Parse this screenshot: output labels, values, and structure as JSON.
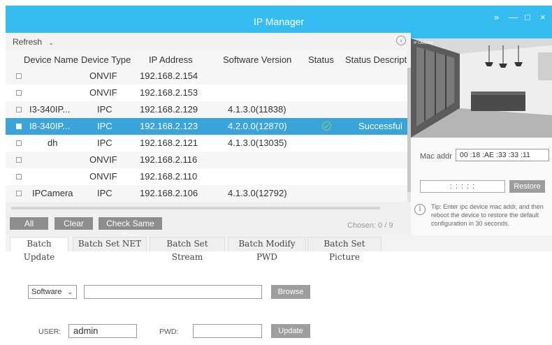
{
  "window": {
    "title": "IP Manager",
    "controls": [
      "»",
      "—",
      "□",
      "×"
    ],
    "accent_color": "#35bdf1",
    "selected_row_color": "#3aa3d9"
  },
  "toolbar": {
    "refresh_label": "Refresh",
    "refresh_icon": "chevron-down-icon",
    "next_icon": "circle-arrow-right-icon"
  },
  "table": {
    "columns": [
      "Device Name",
      "Device Type",
      "IP Address",
      "Software Version",
      "Status",
      "Status Description"
    ],
    "rows": [
      {
        "name": "",
        "type": "ONVIF",
        "ip": "192.168.2.154",
        "version": "",
        "status": "",
        "description": ""
      },
      {
        "name": "",
        "type": "ONVIF",
        "ip": "192.168.2.153",
        "version": "",
        "status": "",
        "description": ""
      },
      {
        "name": "I3-340IP...",
        "type": "IPC",
        "ip": "192.168.2.129",
        "version": "4.1.3.0(11838)",
        "status": "",
        "description": ""
      },
      {
        "name": "I8-340IP...",
        "type": "IPC",
        "ip": "192.168.2.123",
        "version": "4.2.0.0(12870)",
        "status": "ok",
        "description": "Successful"
      },
      {
        "name": "dh",
        "type": "IPC",
        "ip": "192.168.2.121",
        "version": "4.1.3.0(13035)",
        "status": "",
        "description": ""
      },
      {
        "name": "",
        "type": "ONVIF",
        "ip": "192.168.2.116",
        "version": "",
        "status": "",
        "description": ""
      },
      {
        "name": "",
        "type": "ONVIF",
        "ip": "192.168.2.110",
        "version": "",
        "status": "",
        "description": ""
      },
      {
        "name": "IPCamera",
        "type": "IPC",
        "ip": "192.168.2.106",
        "version": "4.1.3.0(12792)",
        "status": "",
        "description": ""
      }
    ]
  },
  "actions": {
    "all": "All",
    "clear": "Clear",
    "check_same_type": "Check Same Type",
    "chosen": "Chosen:  0  /  9"
  },
  "right": {
    "mac_label": "Mac addr",
    "mac_value": "00 :18 :AE :33 :33 :11",
    "mac_input": ":   :   :   :   :",
    "restore": "Restore",
    "tip": "Tip: Enter ipc device mac addr, and then reboot the device to restore the default configuration in 30 seconds."
  },
  "tabs": [
    "Batch Update",
    "Batch Set NET",
    "Batch Set Stream",
    "Batch Modify PWD",
    "Batch Set Picture"
  ],
  "update": {
    "type_select": "Software",
    "browse": "Browse",
    "user_label": "USER:",
    "user_value": "admin",
    "pwd_label": "PWD:",
    "update": "Update"
  }
}
